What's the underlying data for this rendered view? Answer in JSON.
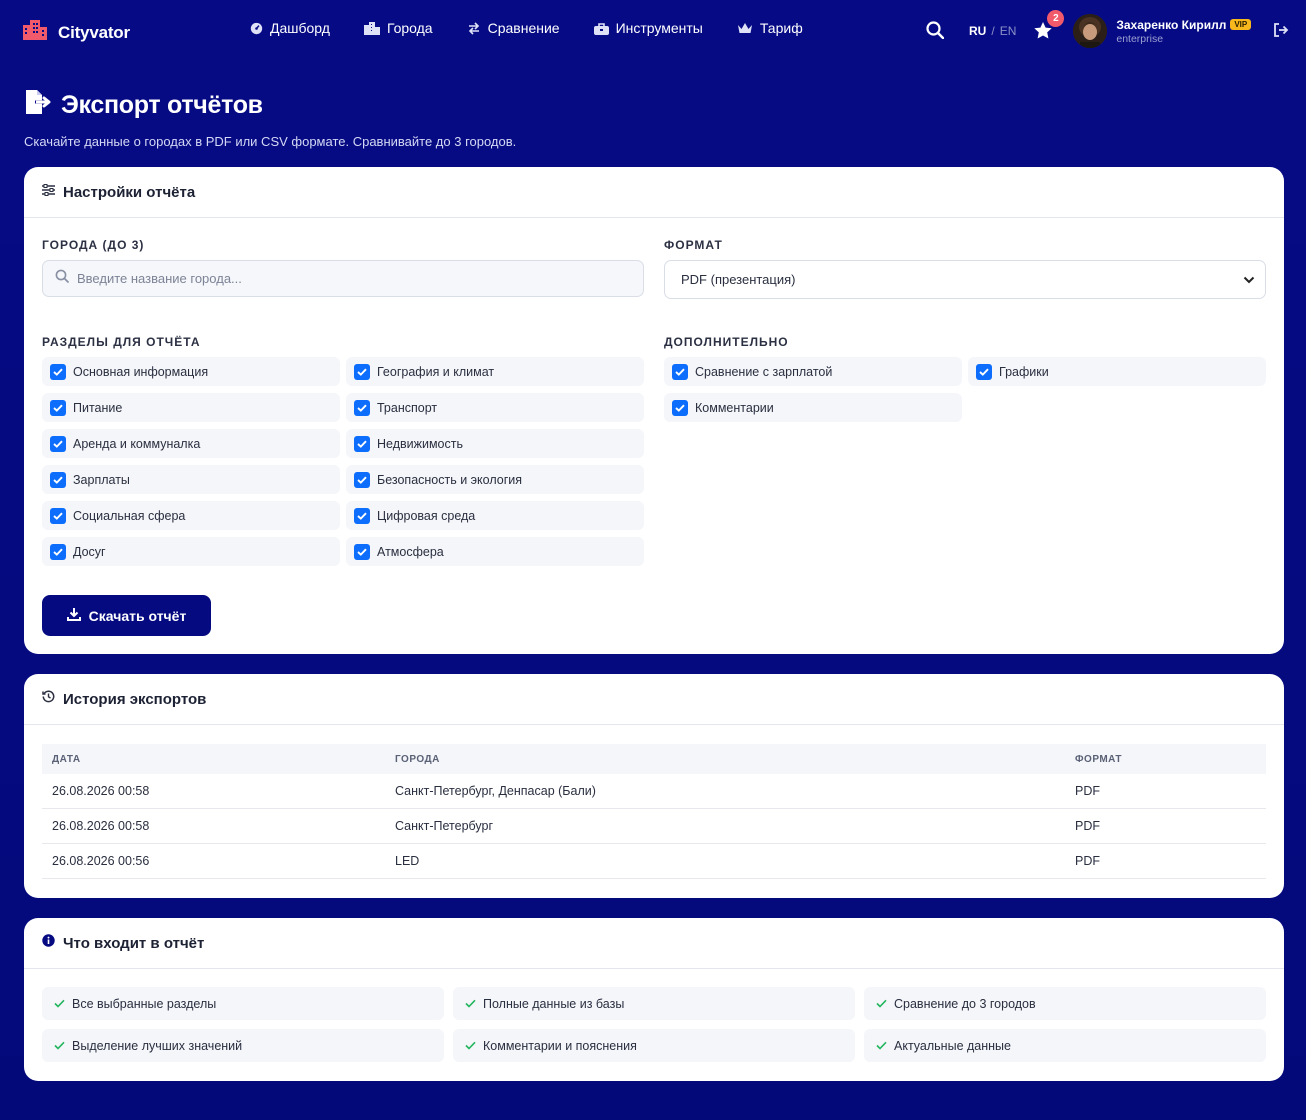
{
  "brand": {
    "name": "Cityvator",
    "icon": "city-icon",
    "accent": "#f15a6b"
  },
  "nav": {
    "links": [
      {
        "label": "Дашборд",
        "icon": "gauge-icon"
      },
      {
        "label": "Города",
        "icon": "city-icon"
      },
      {
        "label": "Сравнение",
        "icon": "compare-icon"
      },
      {
        "label": "Инструменты",
        "icon": "toolbox-icon"
      },
      {
        "label": "Тариф",
        "icon": "crown-icon"
      }
    ],
    "lang_active": "RU",
    "lang_sep": "/",
    "lang_other": "EN",
    "favorites_count": "2",
    "user_name": "Захаренко Кирилл",
    "user_badge": "VIP",
    "user_plan": "enterprise"
  },
  "page": {
    "title": "Экспорт отчётов",
    "subtitle": "Скачайте данные о городах в PDF или CSV формате. Сравнивайте до 3 городов."
  },
  "settings": {
    "title": "Настройки отчёта",
    "cities_label": "Города (до 3)",
    "cities_placeholder": "Введите название города...",
    "format_label": "Формат",
    "format_value": "PDF (презентация)",
    "sections_label": "Разделы для отчёта",
    "sections": [
      {
        "label": "Основная информация",
        "checked": true
      },
      {
        "label": "География и климат",
        "checked": true
      },
      {
        "label": "Питание",
        "checked": true
      },
      {
        "label": "Транспорт",
        "checked": true
      },
      {
        "label": "Аренда и коммуналка",
        "checked": true
      },
      {
        "label": "Недвижимость",
        "checked": true
      },
      {
        "label": "Зарплаты",
        "checked": true
      },
      {
        "label": "Безопасность и экология",
        "checked": true
      },
      {
        "label": "Социальная сфера",
        "checked": true
      },
      {
        "label": "Цифровая среда",
        "checked": true
      },
      {
        "label": "Досуг",
        "checked": true
      },
      {
        "label": "Атмосфера",
        "checked": true
      }
    ],
    "extra_label": "Дополнительно",
    "extras": [
      {
        "label": "Сравнение с зарплатой",
        "checked": true
      },
      {
        "label": "Графики",
        "checked": true
      },
      {
        "label": "Комментарии",
        "checked": true
      }
    ],
    "download_label": "Скачать отчёт"
  },
  "history": {
    "title": "История экспортов",
    "columns": [
      "Дата",
      "Города",
      "Формат"
    ],
    "rows": [
      [
        "26.08.2026 00:58",
        "Санкт-Петербург, Денпасар (Бали)",
        "PDF"
      ],
      [
        "26.08.2026 00:58",
        "Санкт-Петербург",
        "PDF"
      ],
      [
        "26.08.2026 00:56",
        "LED",
        "PDF"
      ]
    ]
  },
  "included": {
    "title": "Что входит в отчёт",
    "items": [
      "Все выбранные разделы",
      "Полные данные из базы",
      "Сравнение до 3 городов",
      "Выделение лучших значений",
      "Комментарии и пояснения",
      "Актуальные данные"
    ]
  }
}
